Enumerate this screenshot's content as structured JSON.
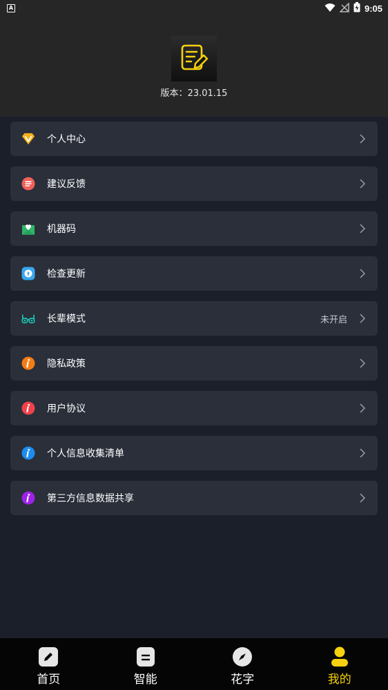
{
  "status_bar": {
    "time": "9:05",
    "sim_label": "A"
  },
  "header": {
    "version_label": "版本：",
    "version_value": "23.01.15"
  },
  "menu": [
    {
      "label": "个人中心",
      "icon": "vip-diamond-icon",
      "color": "#f5b21a",
      "value": ""
    },
    {
      "label": "建议反馈",
      "icon": "feedback-icon",
      "color": "#f0605a",
      "value": ""
    },
    {
      "label": "机器码",
      "icon": "machine-code-icon",
      "color": "#2fb56a",
      "value": ""
    },
    {
      "label": "检查更新",
      "icon": "update-icon",
      "color": "#3aa7f0",
      "value": ""
    },
    {
      "label": "长辈模式",
      "icon": "glasses-icon",
      "color": "#1ec6b4",
      "value": "未开启"
    },
    {
      "label": "隐私政策",
      "icon": "info-icon",
      "color": "#f57c14",
      "value": ""
    },
    {
      "label": "用户协议",
      "icon": "info-icon",
      "color": "#f0424b",
      "value": ""
    },
    {
      "label": "个人信息收集清单",
      "icon": "info-icon",
      "color": "#1d8cf0",
      "value": ""
    },
    {
      "label": "第三方信息数据共享",
      "icon": "info-icon",
      "color": "#9d22e8",
      "value": ""
    }
  ],
  "tabs": [
    {
      "label": "首页",
      "icon": "pencil-icon",
      "active": false
    },
    {
      "label": "智能",
      "icon": "smart-icon",
      "active": false
    },
    {
      "label": "花字",
      "icon": "compass-icon",
      "active": false
    },
    {
      "label": "我的",
      "icon": "user-icon",
      "active": true
    }
  ],
  "colors": {
    "accent": "#f5d10f",
    "background": "#1b1f2a",
    "card": "#2a2f3a",
    "header": "#262626"
  }
}
